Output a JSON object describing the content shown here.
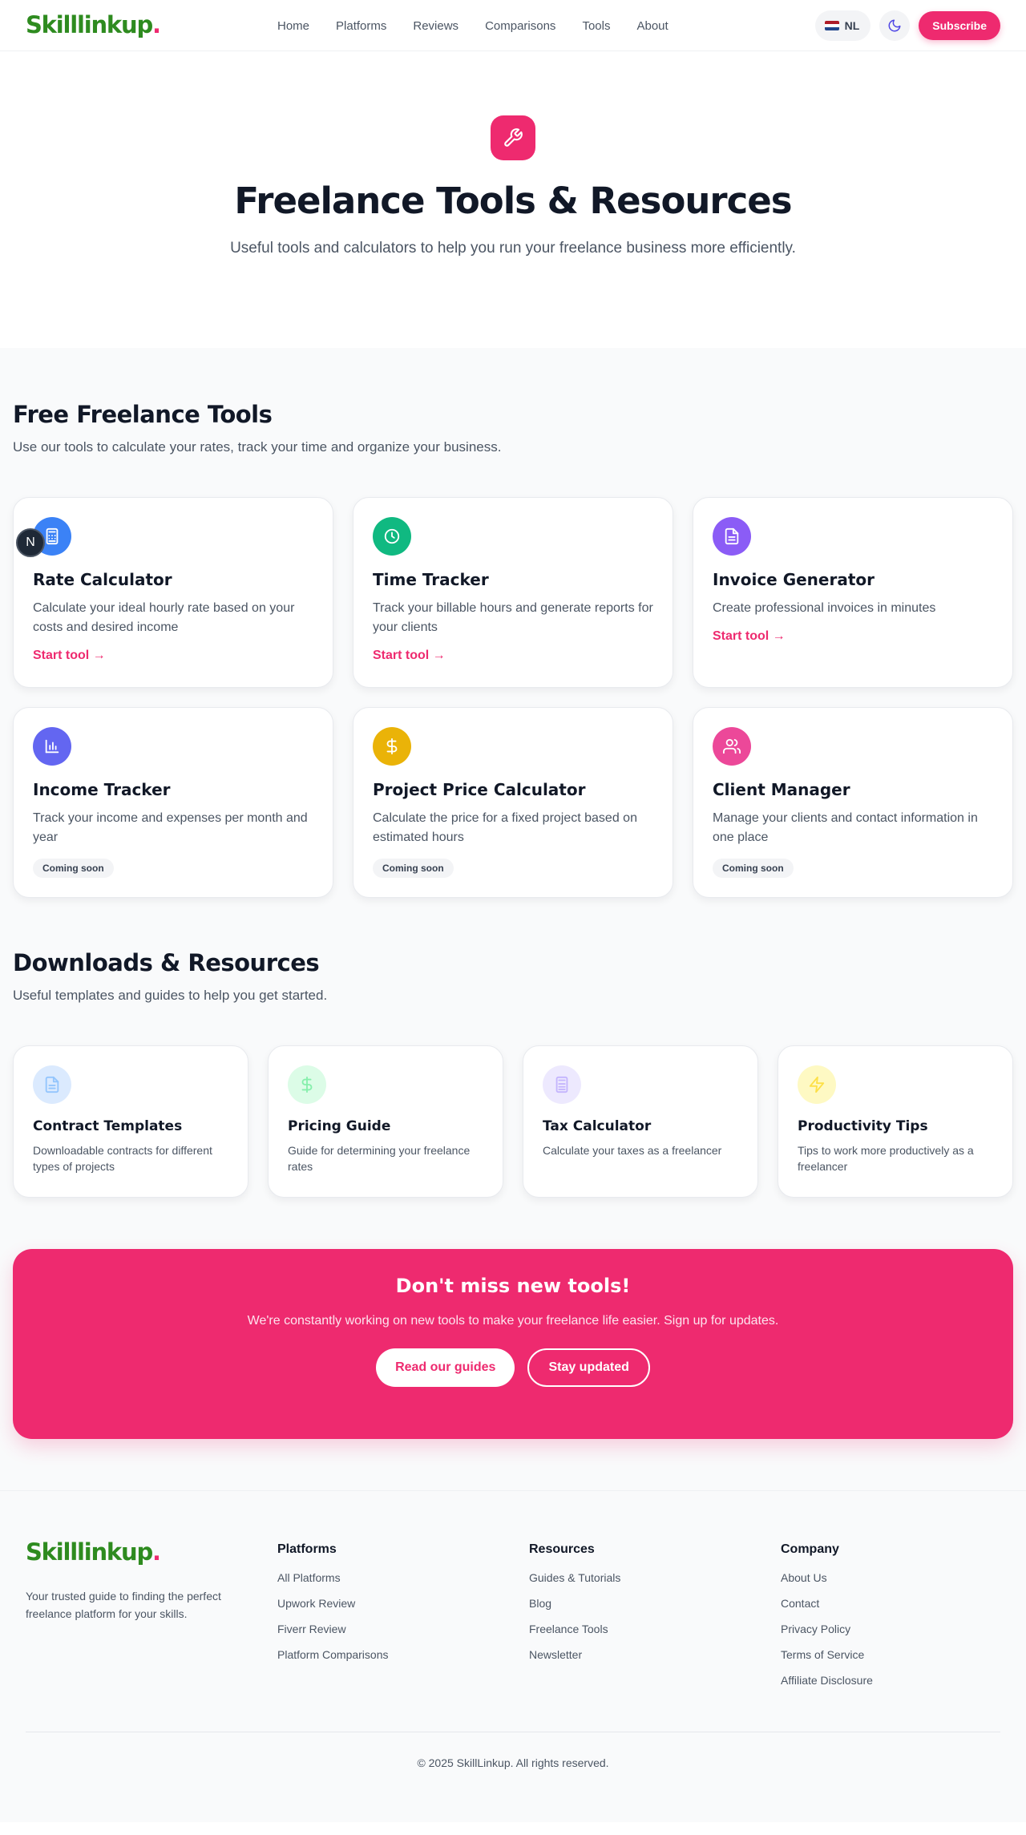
{
  "brand": {
    "name": "Skilllinkup",
    "dot": ".",
    "accent_color": "#ee2a6f",
    "logo_color": "#2e8b1f"
  },
  "nav": {
    "links": [
      "Home",
      "Platforms",
      "Reviews",
      "Comparisons",
      "Tools",
      "About"
    ],
    "language": "NL",
    "subscribe_label": "Subscribe"
  },
  "hero": {
    "icon": "wrench-icon",
    "title": "Freelance Tools & Resources",
    "subtitle": "Useful tools and calculators to help you run your freelance business more efficiently."
  },
  "tools_section": {
    "title": "Free Freelance Tools",
    "subtitle": "Use our tools to calculate your rates, track your time and organize your business.",
    "floating_badge": "N",
    "cards": [
      {
        "title": "Rate Calculator",
        "description": "Calculate your ideal hourly rate based on your costs and desired income",
        "action": "Start tool →",
        "icon": "calculator-icon",
        "color": "#3b82f6"
      },
      {
        "title": "Time Tracker",
        "description": "Track your billable hours and generate reports for your clients",
        "action": "Start tool →",
        "icon": "clock-icon",
        "color": "#10b981"
      },
      {
        "title": "Invoice Generator",
        "description": "Create professional invoices in minutes",
        "action": "Start tool →",
        "icon": "document-icon",
        "color": "#8b5cf6"
      },
      {
        "title": "Income Tracker",
        "description": "Track your income and expenses per month and year",
        "badge": "Coming soon",
        "icon": "bar-chart-icon",
        "color": "#6366f1"
      },
      {
        "title": "Project Price Calculator",
        "description": "Calculate the price for a fixed project based on estimated hours",
        "badge": "Coming soon",
        "icon": "dollar-icon",
        "color": "#eab308"
      },
      {
        "title": "Client Manager",
        "description": "Manage your clients and contact information in one place",
        "badge": "Coming soon",
        "icon": "users-icon",
        "color": "#ec4899"
      }
    ]
  },
  "downloads_section": {
    "title": "Downloads & Resources",
    "subtitle": "Useful templates and guides to help you get started.",
    "cards": [
      {
        "title": "Contract Templates",
        "description": "Downloadable contracts for different types of projects",
        "icon": "document-icon",
        "color": "#dbeafe",
        "icon_color": "#93c5fd"
      },
      {
        "title": "Pricing Guide",
        "description": "Guide for determining your freelance rates",
        "icon": "dollar-icon",
        "color": "#dcfce7",
        "icon_color": "#86efac"
      },
      {
        "title": "Tax Calculator",
        "description": "Calculate your taxes as a freelancer",
        "icon": "calculator-icon",
        "color": "#ede9fe",
        "icon_color": "#c4b5fd"
      },
      {
        "title": "Productivity Tips",
        "description": "Tips to work more productively as a freelancer",
        "icon": "lightning-icon",
        "color": "#fef9c3",
        "icon_color": "#fde047"
      }
    ]
  },
  "cta": {
    "title": "Don't miss new tools!",
    "text": "We're constantly working on new tools to make your freelance life easier. Sign up for updates.",
    "primary_label": "Read our guides",
    "secondary_label": "Stay updated"
  },
  "footer": {
    "tagline": "Your trusted guide to finding the perfect freelance platform for your skills.",
    "columns": [
      {
        "title": "Platforms",
        "links": [
          "All Platforms",
          "Upwork Review",
          "Fiverr Review",
          "Platform Comparisons"
        ]
      },
      {
        "title": "Resources",
        "links": [
          "Guides & Tutorials",
          "Blog",
          "Freelance Tools",
          "Newsletter"
        ]
      },
      {
        "title": "Company",
        "links": [
          "About Us",
          "Contact",
          "Privacy Policy",
          "Terms of Service",
          "Affiliate Disclosure"
        ]
      }
    ],
    "copyright": "© 2025 SkillLinkup. All rights reserved."
  }
}
